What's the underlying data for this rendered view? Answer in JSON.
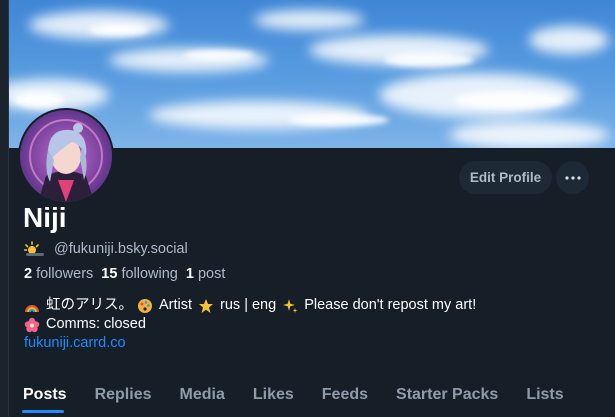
{
  "header": {
    "edit_profile_label": "Edit Profile",
    "more_label": "···"
  },
  "profile": {
    "display_name": "Niji",
    "handle": "@fukuniji.bsky.social",
    "handle_icon": "sun-behind-cloud-icon",
    "followers_count": "2",
    "followers_label": "followers",
    "following_count": "15",
    "following_label": "following",
    "posts_count": "1",
    "posts_label": "post",
    "bio": {
      "line1": {
        "rainbow": "虹のアリス。",
        "artist": "Artist",
        "langs": "rus | eng",
        "request": "Please don't repost my art!"
      },
      "line2": "Comms: closed",
      "link": "fukuniji.carrd.co"
    }
  },
  "tabs": [
    {
      "label": "Posts",
      "active": true
    },
    {
      "label": "Replies",
      "active": false
    },
    {
      "label": "Media",
      "active": false
    },
    {
      "label": "Likes",
      "active": false
    },
    {
      "label": "Feeds",
      "active": false
    },
    {
      "label": "Starter Packs",
      "active": false
    },
    {
      "label": "Lists",
      "active": false
    }
  ],
  "colors": {
    "background": "#161e27",
    "accent": "#208bfe",
    "muted": "#aebbc9"
  }
}
